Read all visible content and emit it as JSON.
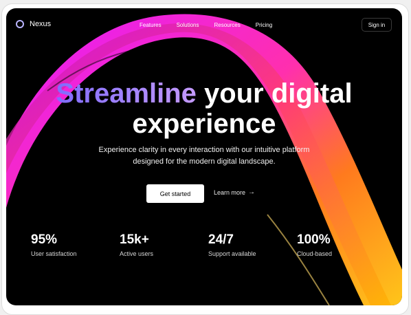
{
  "brand": {
    "name": "Nexus"
  },
  "nav": {
    "links": [
      "Features",
      "Solutions",
      "Resources",
      "Pricing"
    ],
    "signin": "Sign in"
  },
  "hero": {
    "headline_accent": "Streamline",
    "headline_rest": " your digital",
    "headline_line2": "experience",
    "subtitle_line1": "Experience clarity in every interaction with our intuitive platform",
    "subtitle_line2": "designed for the modern digital landscape.",
    "cta_primary": "Get started",
    "cta_secondary": "Learn more"
  },
  "stats": [
    {
      "value": "95%",
      "label": "User satisfaction"
    },
    {
      "value": "15k+",
      "label": "Active users"
    },
    {
      "value": "24/7",
      "label": "Support available"
    },
    {
      "value": "100%",
      "label": "Cloud-based"
    }
  ],
  "icons": {
    "logo": "ring-logo-icon",
    "arrow": "arrow-right-icon"
  },
  "colors": {
    "background": "#000000",
    "accent_start": "#7f6bff",
    "wave_pink": "#e024ff",
    "wave_orange": "#ff8a1f",
    "wave_yellow": "#ffc21a"
  }
}
